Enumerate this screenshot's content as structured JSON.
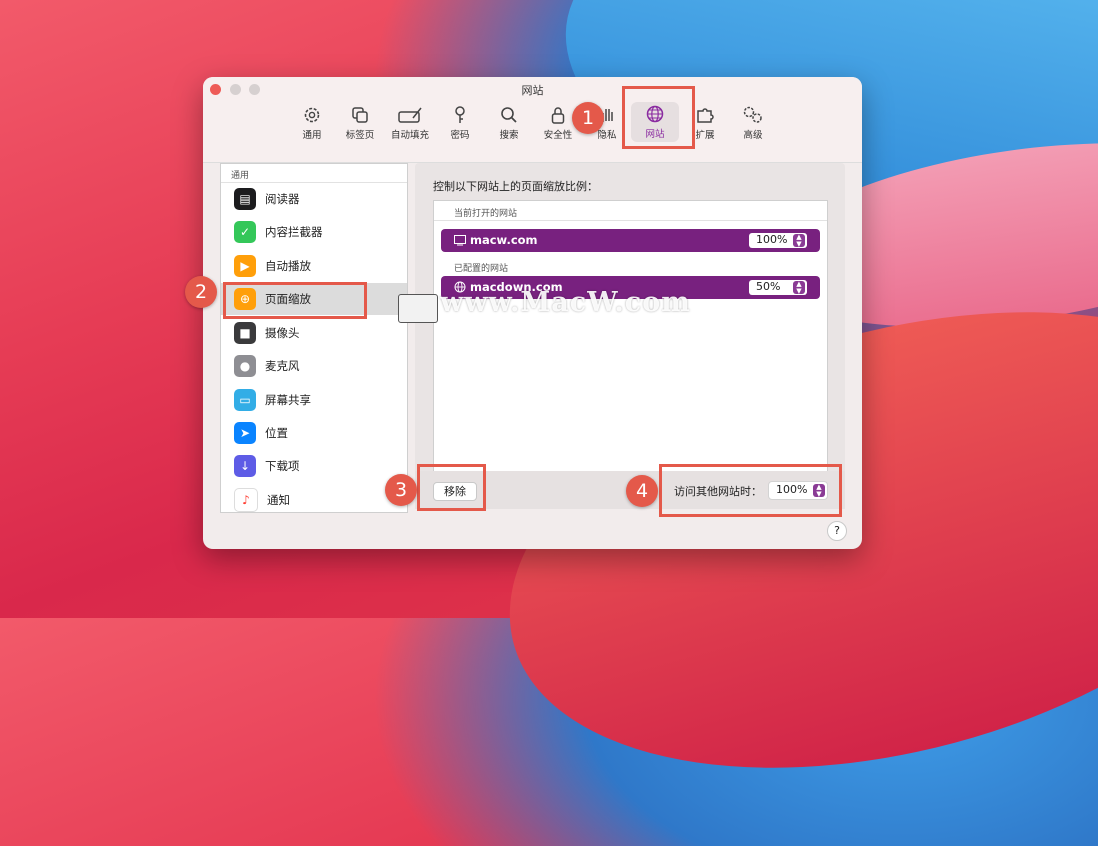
{
  "window": {
    "title": "网站"
  },
  "toolbar": [
    {
      "label": "通用",
      "icon": "gear-icon"
    },
    {
      "label": "标签页",
      "icon": "tabs-icon"
    },
    {
      "label": "自动填充",
      "icon": "autofill-icon"
    },
    {
      "label": "密码",
      "icon": "key-icon"
    },
    {
      "label": "搜索",
      "icon": "search-icon"
    },
    {
      "label": "安全性",
      "icon": "lock-icon"
    },
    {
      "label": "隐私",
      "icon": "hand-icon"
    },
    {
      "label": "网站",
      "icon": "globe-icon"
    },
    {
      "label": "扩展",
      "icon": "puzzle-icon"
    },
    {
      "label": "高级",
      "icon": "gears-icon"
    }
  ],
  "sidebar": {
    "header": "通用",
    "items": [
      {
        "label": "阅读器",
        "icon": "reader-icon",
        "color": "#1c1c1e"
      },
      {
        "label": "内容拦截器",
        "icon": "content-blocker-icon",
        "color": "#34c759"
      },
      {
        "label": "自动播放",
        "icon": "autoplay-icon",
        "color": "#ff9f0a"
      },
      {
        "label": "页面缩放",
        "icon": "page-zoom-icon",
        "color": "#ff9f0a"
      },
      {
        "label": "摄像头",
        "icon": "camera-icon",
        "color": "#3a3a3c"
      },
      {
        "label": "麦克风",
        "icon": "microphone-icon",
        "color": "#8e8e93"
      },
      {
        "label": "屏幕共享",
        "icon": "screen-sharing-icon",
        "color": "#32ade6"
      },
      {
        "label": "位置",
        "icon": "location-icon",
        "color": "#0a84ff"
      },
      {
        "label": "下载项",
        "icon": "downloads-icon",
        "color": "#5e5ce6"
      },
      {
        "label": "通知",
        "icon": "notifications-icon",
        "color": "#ff3b30"
      }
    ]
  },
  "main": {
    "heading": "控制以下网站上的页面缩放比例：",
    "open_section": "当前打开的网站",
    "configured_section": "已配置的网站",
    "open_sites": [
      {
        "site": "macw.com",
        "zoom": "100%"
      }
    ],
    "configured_sites": [
      {
        "site": "macdown.com",
        "zoom": "50%"
      }
    ],
    "remove_button": "移除",
    "other_label": "访问其他网站时：",
    "other_value": "100%",
    "help": "?"
  },
  "annotations": {
    "badge1": "1",
    "badge2": "2",
    "badge3": "3",
    "badge4": "4",
    "watermark": "www.MacW.com"
  },
  "colors": {
    "accent": "#78217f",
    "highlight": "#e4594a"
  }
}
